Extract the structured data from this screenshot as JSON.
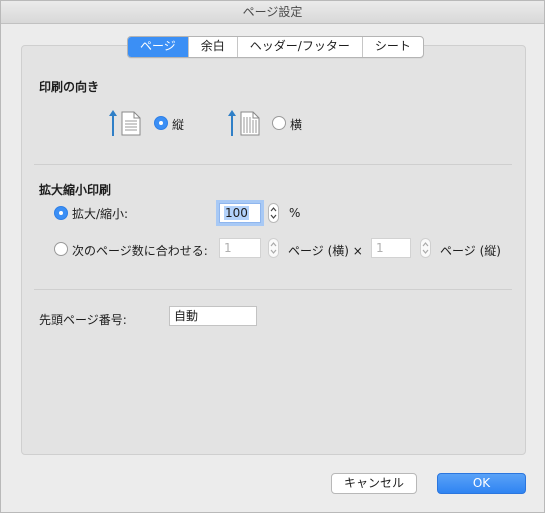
{
  "window": {
    "title": "ページ設定"
  },
  "tabs": [
    {
      "label": "ページ",
      "active": true
    },
    {
      "label": "余白",
      "active": false
    },
    {
      "label": "ヘッダー/フッター",
      "active": false
    },
    {
      "label": "シート",
      "active": false
    }
  ],
  "orientation": {
    "title": "印刷の向き",
    "portrait_label": "縦",
    "landscape_label": "横",
    "selected": "portrait"
  },
  "scaling": {
    "title": "拡大縮小印刷",
    "scale_option_label": "拡大/縮小:",
    "scale_value": "100",
    "percent_label": "%",
    "fit_option_label": "次のページ数に合わせる:",
    "fit_wide_value": "1",
    "fit_wide_label": "ページ (横) ×",
    "fit_tall_value": "1",
    "fit_tall_label": "ページ (縦)",
    "selected": "scale"
  },
  "first_page": {
    "label": "先頭ページ番号:",
    "value": "自動"
  },
  "buttons": {
    "cancel": "キャンセル",
    "ok": "OK"
  },
  "colors": {
    "accent": "#3b8ff5",
    "arrow": "#2f7fc7"
  }
}
